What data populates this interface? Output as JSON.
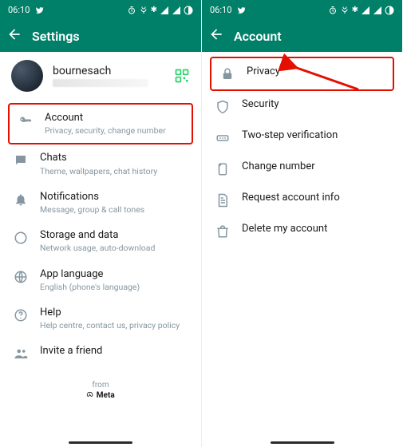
{
  "status": {
    "time": "06:10"
  },
  "left": {
    "title": "Settings",
    "profile": {
      "name": "bournesach",
      "status": ""
    },
    "items": [
      {
        "key": "account",
        "label": "Account",
        "sub": "Privacy, security, change number"
      },
      {
        "key": "chats",
        "label": "Chats",
        "sub": "Theme, wallpapers, chat history"
      },
      {
        "key": "notif",
        "label": "Notifications",
        "sub": "Message, group & call tones"
      },
      {
        "key": "storage",
        "label": "Storage and data",
        "sub": "Network usage, auto-download"
      },
      {
        "key": "lang",
        "label": "App language",
        "sub": "English (phone's language)"
      },
      {
        "key": "help",
        "label": "Help",
        "sub": "Help centre, contact us, privacy policy"
      },
      {
        "key": "invite",
        "label": "Invite a friend",
        "sub": ""
      }
    ],
    "footer": {
      "from": "from",
      "meta": "Meta"
    }
  },
  "right": {
    "title": "Account",
    "items": [
      {
        "key": "privacy",
        "label": "Privacy"
      },
      {
        "key": "security",
        "label": "Security"
      },
      {
        "key": "twostep",
        "label": "Two-step verification"
      },
      {
        "key": "change",
        "label": "Change number"
      },
      {
        "key": "reqinfo",
        "label": "Request account info"
      },
      {
        "key": "delete",
        "label": "Delete my account"
      }
    ]
  },
  "colors": {
    "brand": "#008069",
    "highlight": "#e31000"
  }
}
